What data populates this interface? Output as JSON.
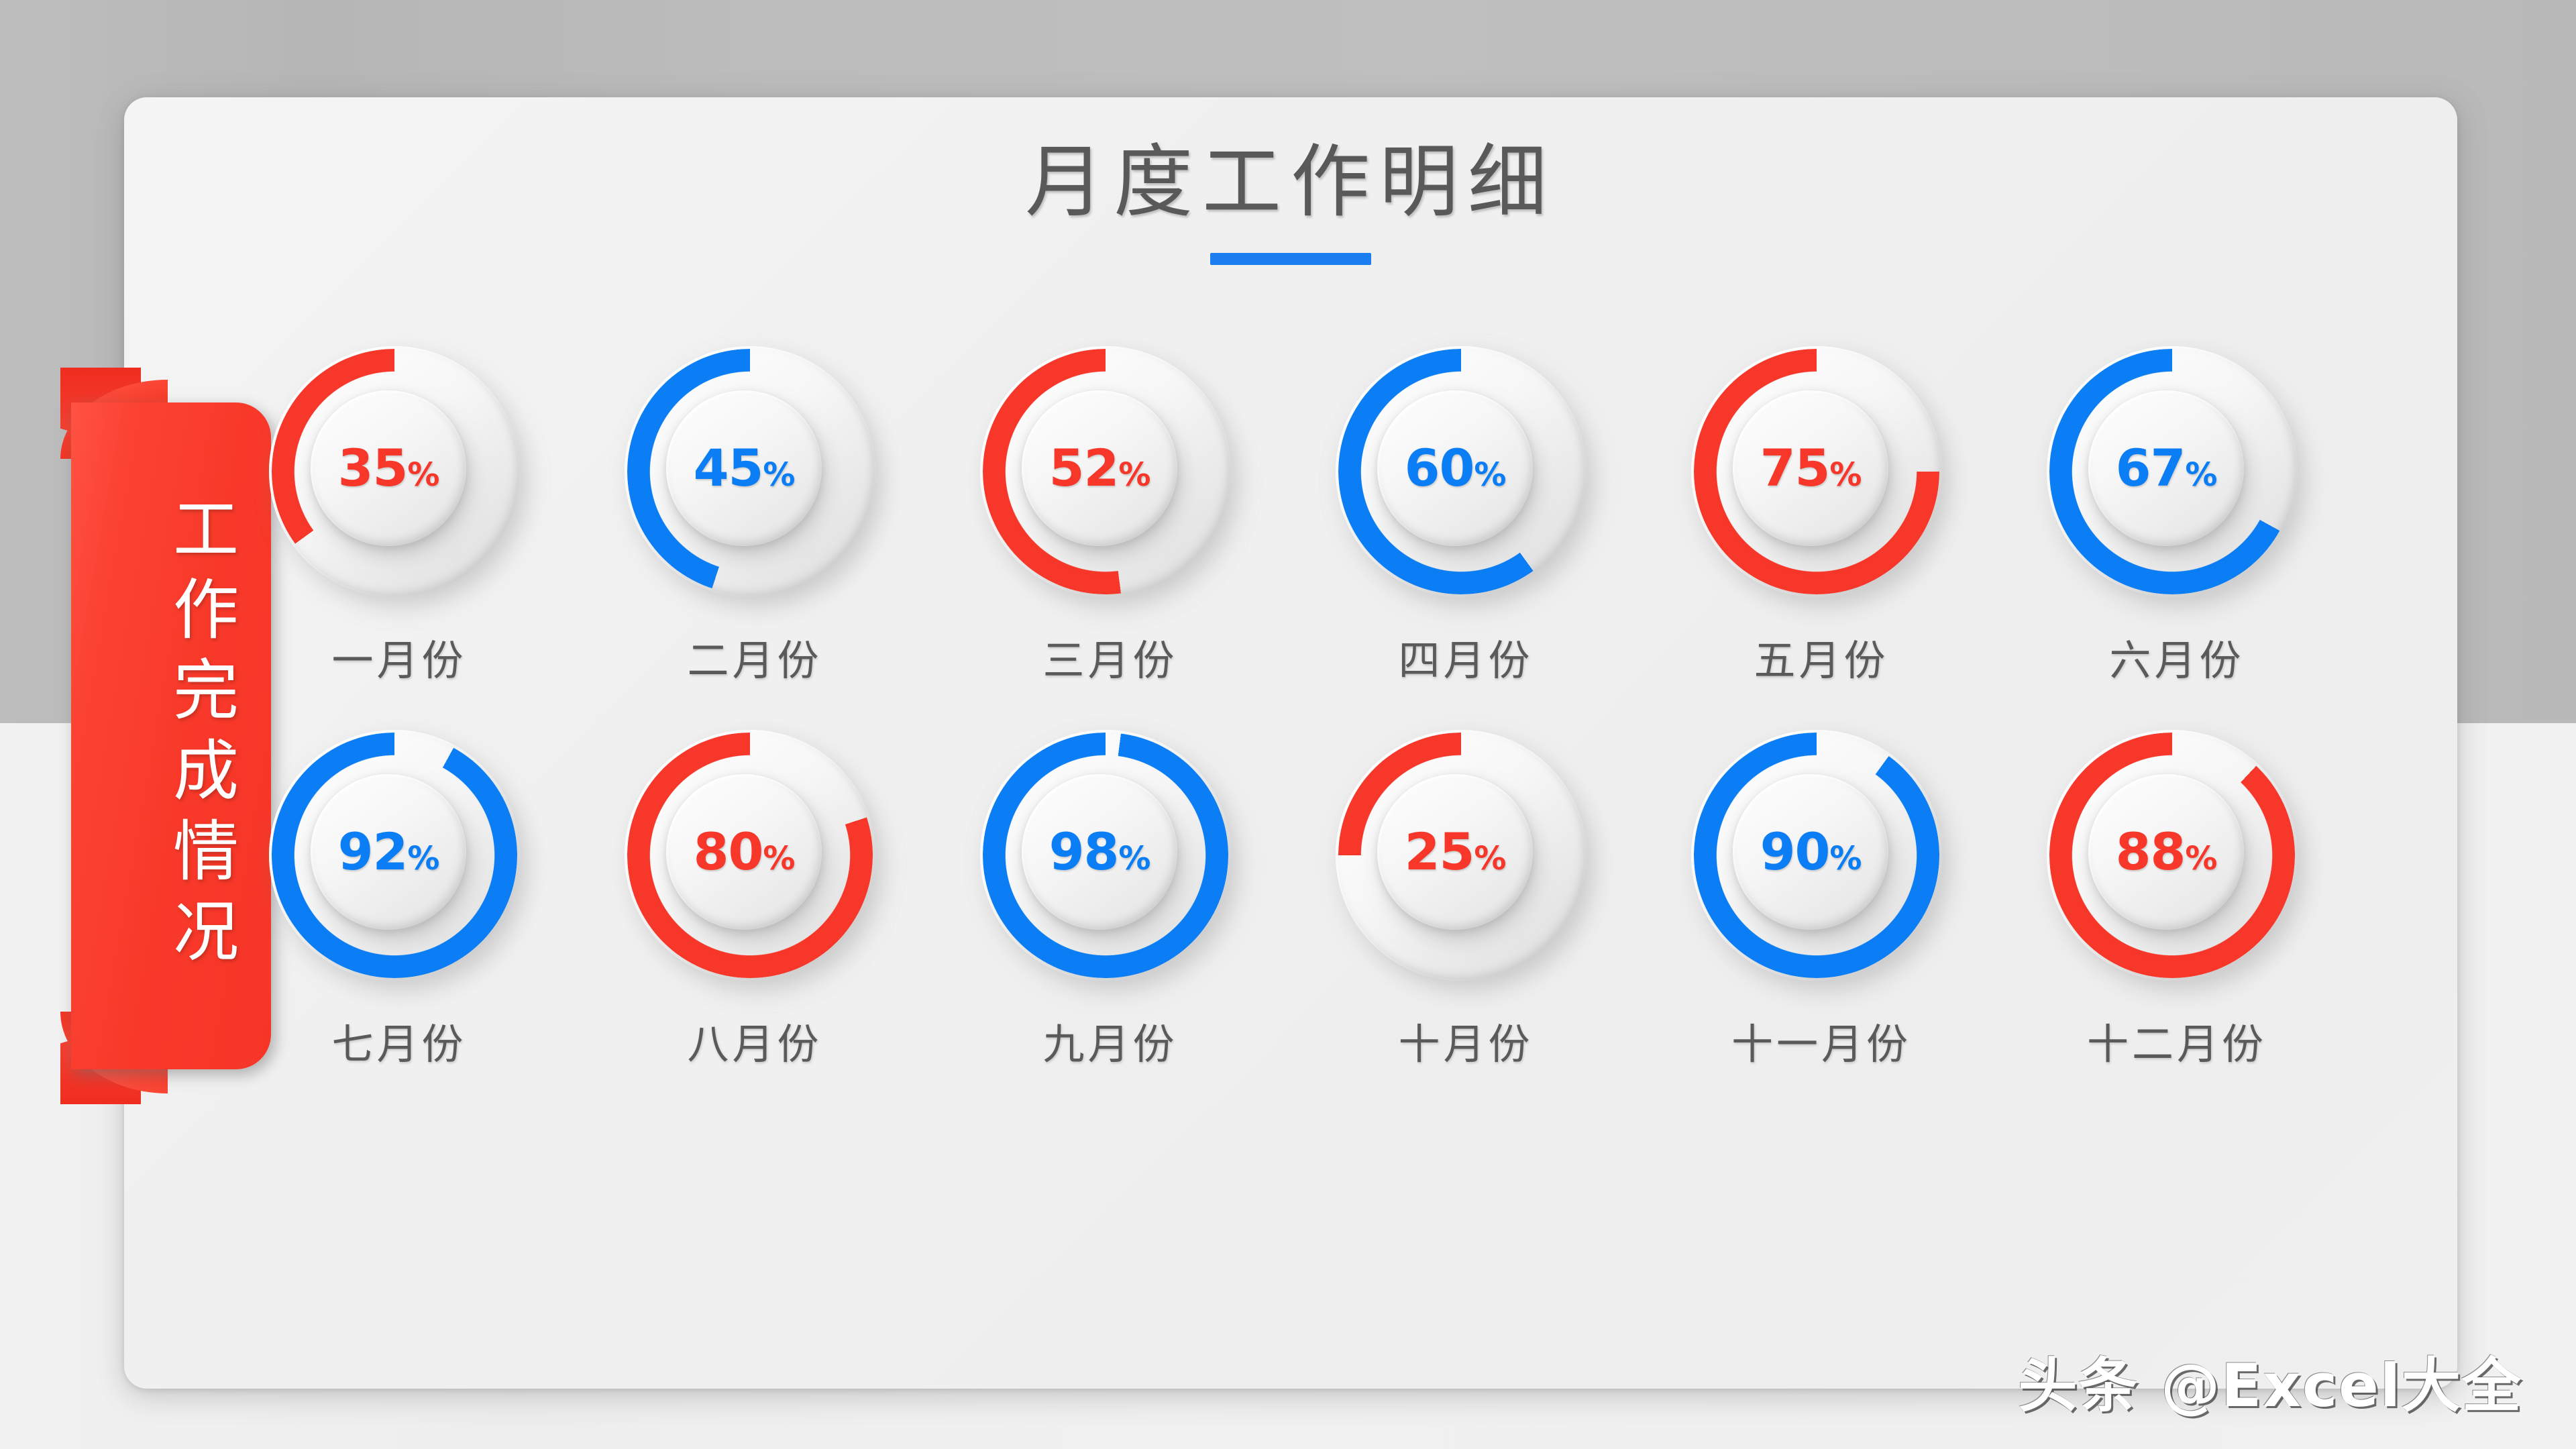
{
  "slide": {
    "title": "月度工作明细",
    "ribbon_label": "工作完成情况",
    "watermark": "头条 @Excel大全"
  },
  "colors": {
    "red": "#f7372a",
    "blue": "#0c7ef5",
    "title_gray": "#595959",
    "label_gray": "#5a5a5a",
    "underline_blue": "#1a7ef0",
    "track_gray": "#e8e8e8",
    "card_bg": "#f0f0f0",
    "page_bg_top": "#bcbcbc",
    "page_bg_bottom": "#f1f1f1"
  },
  "chart_data": {
    "type": "pie",
    "title": "月度工作明细",
    "subtitle": "工作完成情况",
    "units": "%",
    "direction": "counter-clockwise",
    "start_angle_deg": 0,
    "ylim": [
      0,
      100
    ],
    "legend": "none",
    "grid": false,
    "categories": [
      "一月份",
      "二月份",
      "三月份",
      "四月份",
      "五月份",
      "六月份",
      "七月份",
      "八月份",
      "九月份",
      "十月份",
      "十一月份",
      "十二月份"
    ],
    "values": [
      35,
      45,
      52,
      60,
      75,
      67,
      92,
      80,
      98,
      25,
      90,
      88
    ],
    "labels": [
      "35%",
      "45%",
      "52%",
      "60%",
      "75%",
      "67%",
      "92%",
      "80%",
      "98%",
      "25%",
      "90%",
      "88%"
    ],
    "series": [
      {
        "name": "工作完成情况",
        "values": [
          35,
          45,
          52,
          60,
          75,
          67,
          92,
          80,
          98,
          25,
          90,
          88
        ]
      }
    ],
    "items": [
      {
        "month": "一月份",
        "value": 35,
        "label": "35",
        "symbol": "%",
        "color": "#f7372a"
      },
      {
        "month": "二月份",
        "value": 45,
        "label": "45",
        "symbol": "%",
        "color": "#0c7ef5"
      },
      {
        "month": "三月份",
        "value": 52,
        "label": "52",
        "symbol": "%",
        "color": "#f7372a"
      },
      {
        "month": "四月份",
        "value": 60,
        "label": "60",
        "symbol": "%",
        "color": "#0c7ef5"
      },
      {
        "month": "五月份",
        "value": 75,
        "label": "75",
        "symbol": "%",
        "color": "#f7372a"
      },
      {
        "month": "六月份",
        "value": 67,
        "label": "67",
        "symbol": "%",
        "color": "#0c7ef5"
      },
      {
        "month": "七月份",
        "value": 92,
        "label": "92",
        "symbol": "%",
        "color": "#0c7ef5"
      },
      {
        "month": "八月份",
        "value": 80,
        "label": "80",
        "symbol": "%",
        "color": "#f7372a"
      },
      {
        "month": "九月份",
        "value": 98,
        "label": "98",
        "symbol": "%",
        "color": "#0c7ef5"
      },
      {
        "month": "十月份",
        "value": 25,
        "label": "25",
        "symbol": "%",
        "color": "#f7372a"
      },
      {
        "month": "十一月份",
        "value": 90,
        "label": "90",
        "symbol": "#",
        "color": "#0c7ef5"
      },
      {
        "month": "十二月份",
        "value": 88,
        "label": "88",
        "symbol": "%",
        "color": "#f7372a"
      }
    ]
  }
}
